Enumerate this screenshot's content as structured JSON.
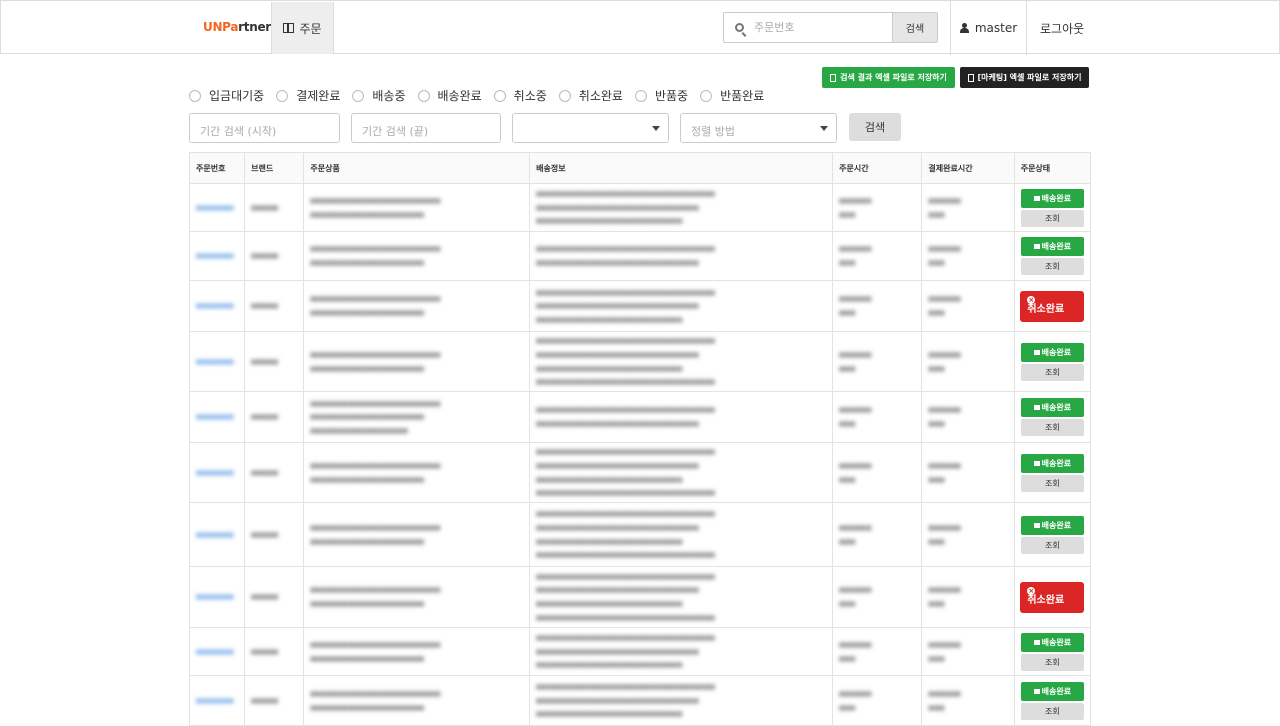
{
  "header": {
    "logo_part1": "UNPa",
    "logo_part2": "rtner",
    "nav_tab": "주문",
    "search_placeholder": "주문번호",
    "search_button": "검색",
    "username": "master",
    "logout": "로그아웃"
  },
  "actions": {
    "excel_search": "검색 결과 엑셀 파일로 저장하기",
    "excel_marketing": "[마케팅] 엑셀 파일로 저장하기"
  },
  "filters": {
    "statuses": [
      "입금대기중",
      "결제완료",
      "배송중",
      "배송완료",
      "취소중",
      "취소완료",
      "반품중",
      "반품완료"
    ],
    "date_start_placeholder": "기간 검색 (시작)",
    "date_end_placeholder": "기간 검색 (끝)",
    "sort_placeholder": "정렬 방법",
    "search_button": "검색"
  },
  "table": {
    "columns": [
      "주문번호",
      "브랜드",
      "주문상품",
      "배송정보",
      "주문시간",
      "결제완료시간",
      "주문상태"
    ],
    "shipped_label": "배송완료",
    "cancelled_label": "취소완료",
    "view_label": "조회"
  },
  "colors": {
    "brand_orange": "#f26522",
    "success": "#28a745",
    "danger": "#dc2626"
  }
}
